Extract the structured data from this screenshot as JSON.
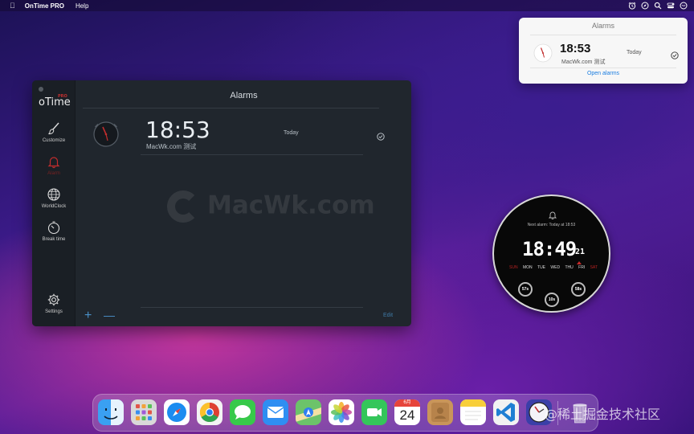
{
  "menubar": {
    "app_name": "OnTime PRO",
    "menus": [
      "Help"
    ]
  },
  "popover": {
    "title": "Alarms",
    "alarm": {
      "time": "18:53",
      "label": "MacWk.com 测试",
      "day": "Today"
    },
    "open_link": "Open alarms"
  },
  "app": {
    "logo": "oTime",
    "logo_badge": "PRO",
    "sidebar": [
      {
        "label": "Customize",
        "icon": "brush-icon"
      },
      {
        "label": "Alarm",
        "icon": "bell-icon",
        "active": true
      },
      {
        "label": "WorldClock",
        "icon": "globe-icon"
      },
      {
        "label": "Break time",
        "icon": "timer-icon"
      },
      {
        "label": "Settings",
        "icon": "gear-icon"
      }
    ],
    "main_title": "Alarms",
    "alarm": {
      "time": "18:53",
      "label": "MacWk.com 测试",
      "day": "Today"
    },
    "watermark": "MacWk.com",
    "footer": {
      "add": "+",
      "remove": "—",
      "edit": "Edit"
    }
  },
  "widget": {
    "next_alarm": "Next alarm: Today at 18:53",
    "time": "18:49",
    "date": "21",
    "days": [
      "SUN",
      "MON",
      "TUE",
      "WED",
      "THU",
      "FRI",
      "SAT"
    ],
    "active_day": "FRI",
    "dials": [
      "57s",
      "10s",
      "58s"
    ]
  },
  "dock": {
    "apps": [
      "Finder",
      "Launchpad",
      "Safari",
      "Chrome",
      "Messages",
      "Mail",
      "Maps",
      "Photos",
      "FaceTime",
      "Calendar",
      "Contacts",
      "Notes",
      "VS Code",
      "OnTime",
      "Trash"
    ],
    "calendar_month": "6月",
    "calendar_day": "24"
  },
  "footer_watermark": "@稀土掘金技术社区",
  "colors": {
    "accent_red": "#c12d2d",
    "link_blue": "#1a7de0",
    "app_bg": "#20262d"
  }
}
